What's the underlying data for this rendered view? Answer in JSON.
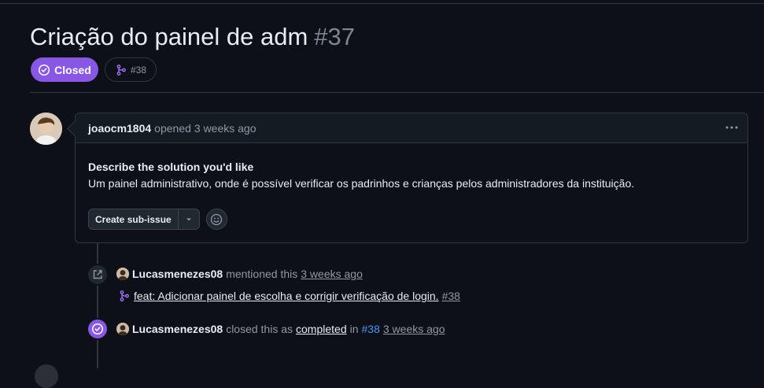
{
  "issue": {
    "title": "Criação do painel de adm",
    "number": "#37",
    "state_label": "Closed",
    "linked_pr": "#38",
    "state_color": "#8957e5"
  },
  "comment": {
    "author": "joaocm1804",
    "action": "opened",
    "time": "3 weeks ago",
    "heading": "Describe the solution you'd like",
    "body": "Um painel administrativo, onde é possível verificar os padrinhos e crianças pelos administradores da instituição.",
    "sub_issue_label": "Create sub-issue"
  },
  "timeline": [
    {
      "icon": "cross-reference-icon",
      "user": "Lucasmenezes08",
      "action": "mentioned this",
      "time": "3 weeks ago",
      "ref_title": "feat: Adicionar painel de escolha e corrigir verificação de login.",
      "ref_number": "#38"
    },
    {
      "icon": "issue-closed-icon",
      "user": "Lucasmenezes08",
      "action": "closed this as",
      "reason": "completed",
      "in_label": "in",
      "pr": "#38",
      "time": "3 weeks ago"
    }
  ]
}
